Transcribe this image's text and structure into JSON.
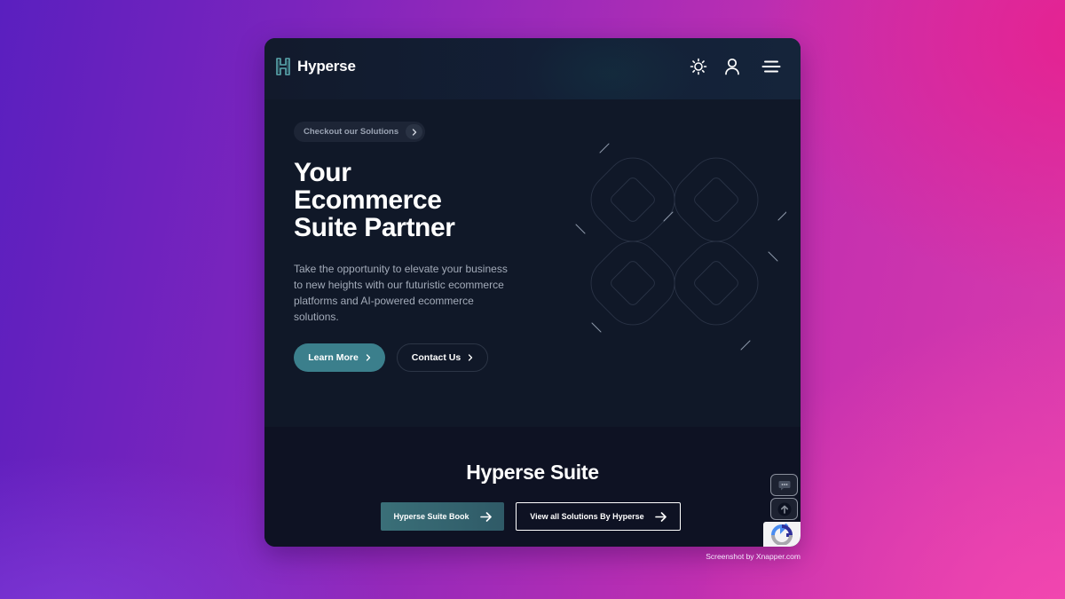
{
  "header": {
    "brand": "Hyperse",
    "icons": [
      "logo-h-icon",
      "sun-icon",
      "user-icon",
      "menu-icon"
    ]
  },
  "hero": {
    "pill_label": "Checkout our Solutions",
    "title_lines": [
      "Your",
      "Ecommerce",
      "Suite Partner"
    ],
    "description": "Take the opportunity to elevate your business to new heights with our futuristic ecommerce platforms and AI-powered ecommerce solutions.",
    "primary_button": "Learn More",
    "secondary_button": "Contact Us"
  },
  "suite": {
    "title": "Hyperse Suite",
    "book_button": "Hyperse Suite Book",
    "view_all_button": "View all Solutions By Hyperse"
  },
  "floating": {
    "chat_icon": "chat-bubble-icon",
    "top_icon": "arrow-up-icon",
    "recaptcha_icon": "recaptcha-icon"
  },
  "watermark": "Screenshot by Xnapper.com",
  "colors": {
    "accent_teal": "#3b7f8c",
    "hero_bg": "#101828",
    "suite_bg": "#0e1223",
    "text_muted": "#a3abb9"
  }
}
